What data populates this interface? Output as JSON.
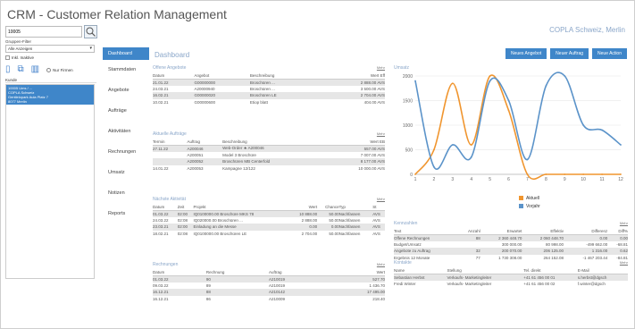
{
  "app": {
    "title": "CRM - Customer Relation Management",
    "company": "COPLA Schweiz, Merlin"
  },
  "left": {
    "search_value": "10005",
    "group_label": "Gruppen-Filter",
    "group_value": "Alle Anzeigen",
    "checkbox_label": "Inkl. Inaktive",
    "radio_label": "Nur Firmen",
    "list_header": "Kunde",
    "selected": [
      "10005 Ums / ...",
      "COPLA Schweiz",
      "Gentlelopark Aula Platz 7",
      "8077 Merlin"
    ]
  },
  "nav": [
    "Dashboard",
    "Stammdaten",
    "Angebote",
    "Aufträge",
    "Aktivitäten",
    "Rechnungen",
    "Umsatz",
    "Notizen",
    "Reports"
  ],
  "main": {
    "title": "Dashboard",
    "buttons": [
      "Neues Angebot",
      "Neuer Auftrag",
      "Neue Action"
    ]
  },
  "offers": {
    "title": "Offene Angebote",
    "more": "Mehr",
    "headers": [
      "Datum",
      "Angebot",
      "Beschreibung",
      "Wert Eff"
    ],
    "rows": [
      [
        "21.01.22",
        "G00000000",
        "Broschüren ...",
        "2 888.00 AVS"
      ],
      [
        "24.03.21",
        "A20000940",
        "Broschüren ...",
        "3 500.00 AVS"
      ],
      [
        "16.02.21",
        "G00000020",
        "Broschüren LE",
        "2 704.00 AVS"
      ],
      [
        "10.02.21",
        "G00000600",
        "Etiop blatt",
        "404.00 AVS"
      ]
    ]
  },
  "orders": {
    "title": "Aktuelle Aufträge",
    "more": "Mehr",
    "headers": [
      "Termin",
      "Auftrag",
      "Beschreibung",
      "Wert EB"
    ],
    "rows": [
      [
        "27.11.22",
        "A200046",
        "Web-Order ★ A200046",
        "557.00 AVS"
      ],
      [
        "",
        "A200051",
        "Model 3 Broschüre",
        "7 007.00 AVS"
      ],
      [
        "",
        "A200052",
        "Broschüren MB Centerfold",
        "8 177.00 AVS"
      ],
      [
        "14.01.22",
        "A200053",
        "Kampagne 12/122",
        "10 000.00 AVS"
      ]
    ]
  },
  "activities": {
    "title": "Nächste Aktivität",
    "more": "Mehr",
    "headers": [
      "Datum",
      "Zeit",
      "Projekt",
      "Wert",
      "Chance",
      "Typ",
      "St"
    ],
    "rows": [
      [
        "01.03.22",
        "02:00",
        "IQ0100000.00 Broschüre MKS 78",
        "10 888.00",
        "50.00",
        "Nachfassen",
        "AVS"
      ],
      [
        "24.03.22",
        "02:08",
        "IQ020000.00 Broschüren ...",
        "2 888.00",
        "50.00",
        "Nachfassen",
        "AVS"
      ],
      [
        "23.03.21",
        "02:00",
        "Einladung an die Messe",
        "0.00",
        "0.00",
        "Nachfassen",
        "AVS"
      ],
      [
        "18.02.21",
        "02:08",
        "IQ0100000.00 Broschüren LE",
        "2 704.00",
        "50.00",
        "Nachfassen",
        "AVS"
      ]
    ]
  },
  "invoices": {
    "title": "Rechnungen",
    "more": "Mehr",
    "headers": [
      "Datum",
      "Rechnung",
      "Auftrag",
      "Wert"
    ],
    "rows": [
      [
        "01.03.22",
        "90",
        "A210019",
        "527.70"
      ],
      [
        "09.03.22",
        "89",
        "A210019",
        "1 436.70"
      ],
      [
        "16.12.21",
        "88",
        "A210142",
        "17 495.00"
      ],
      [
        "16.12.21",
        "86",
        "A210009",
        "218.40"
      ]
    ]
  },
  "kennzahlen": {
    "title": "Kennzahlen",
    "more": "Mehr",
    "headers": [
      "Text",
      "Anzahl",
      "Erwartet",
      "Effektiv",
      "Differenz",
      "Diff%"
    ],
    "rows": [
      [
        "Offene Rechnungen",
        "88",
        "2 360 448.70",
        "2 060 448.70",
        "0.00",
        "0.00"
      ],
      [
        "Budget/Umsatz",
        "",
        "300 000.00",
        "80 998.00",
        "-499 662.00",
        "-68.81"
      ],
      [
        "Angebote zu Auftrag",
        "32",
        "200 070.00",
        "206 125.00",
        "1 316.00",
        "0.62"
      ],
      [
        "Ergebnis 12 Monate",
        "77",
        "1 730 308.00",
        "264 152.08",
        "-1 467 203.44",
        "-84.81"
      ]
    ]
  },
  "contacts": {
    "title": "Kontakte",
    "more": "Mehr",
    "headers": [
      "Name",
      "Stellung",
      "Tel. direkt",
      "E-Mail"
    ],
    "rows": [
      [
        "Sebastian Herbst",
        "Verkaufs- Marketingleiter",
        "+41 61 456 00 01",
        "s.herbst@dgsch"
      ],
      [
        "Fredi Winter",
        "Verkaufs- Marketingleiter",
        "+41 61 456 00 02",
        "f.winter@dgsch"
      ]
    ]
  },
  "chart": {
    "title": "Umsatz",
    "legend": [
      "Aktuell",
      "Vorjahr"
    ],
    "colors": {
      "Aktuell": "#f0952e",
      "Vorjahr": "#5b93c9"
    }
  },
  "chart_data": {
    "type": "line",
    "title": "Umsatz",
    "x": [
      1,
      2,
      3,
      4,
      5,
      6,
      7,
      8,
      9,
      10,
      11,
      12
    ],
    "yticks": [
      "0",
      "500",
      "1000",
      "1500",
      "2000"
    ],
    "ylim": [
      0,
      2000
    ],
    "series": [
      {
        "name": "Aktuell",
        "values": [
          0,
          500,
          1850,
          600,
          2000,
          1300,
          0,
          0,
          0,
          0,
          0,
          0
        ]
      },
      {
        "name": "Vorjahr",
        "values": [
          1900,
          150,
          600,
          350,
          1900,
          1500,
          300,
          1800,
          2000,
          1000,
          900,
          600
        ]
      }
    ]
  }
}
